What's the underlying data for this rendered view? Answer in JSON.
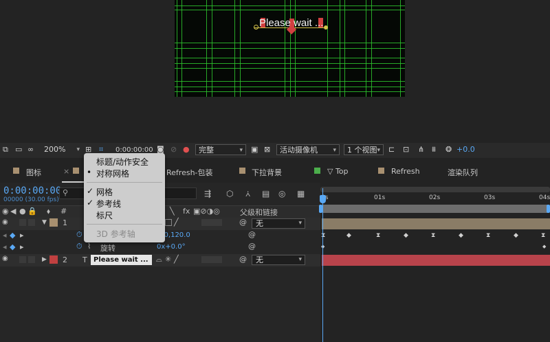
{
  "composition": {
    "overlay_text": "Please wait ..."
  },
  "toolbar": {
    "zoom": "200%",
    "timecode": "0:00:00:00",
    "resolution": "完整",
    "camera": "活动摄像机",
    "views": "1 个视图",
    "exposure": "+0.0"
  },
  "tabs": [
    {
      "label": "图标",
      "color": "#a89070"
    },
    {
      "label": "Refresh-包装",
      "color": "#a89070"
    },
    {
      "label": "下拉背景",
      "color": "#a89070"
    },
    {
      "label": "▽ Top",
      "color": "#4cae4c"
    },
    {
      "label": "Refresh",
      "color": "#a89070"
    },
    {
      "label": "渲染队列",
      "color": ""
    }
  ],
  "timeline": {
    "timecode": "0:00:00:00",
    "fps": "00000 (30.00 fps)",
    "search_icon": "search-icon",
    "col_number": "#",
    "col_parent": "父级和链接",
    "ruler": [
      "01s",
      "02s",
      "03s",
      "04s"
    ],
    "ruler_start": "0s",
    "layers": [
      {
        "index": "1",
        "name": "",
        "parent": "无",
        "color": "#a89070",
        "properties": [
          {
            "name": "",
            "value": "0.0,120.0"
          },
          {
            "name": "旋转",
            "value": "0x+0.0°"
          }
        ]
      },
      {
        "index": "2",
        "type": "T",
        "name": "Please wait ...",
        "parent": "无",
        "color": "#c04040"
      }
    ]
  },
  "menu": {
    "items": [
      {
        "label": "标题/动作安全",
        "mark": ""
      },
      {
        "label": "对称网格",
        "mark": "•"
      },
      {
        "label": "网格",
        "mark": "✓"
      },
      {
        "label": "参考线",
        "mark": "✓"
      },
      {
        "label": "标尺",
        "mark": ""
      },
      {
        "label": "3D 参考轴",
        "mark": "",
        "disabled": true
      }
    ]
  }
}
